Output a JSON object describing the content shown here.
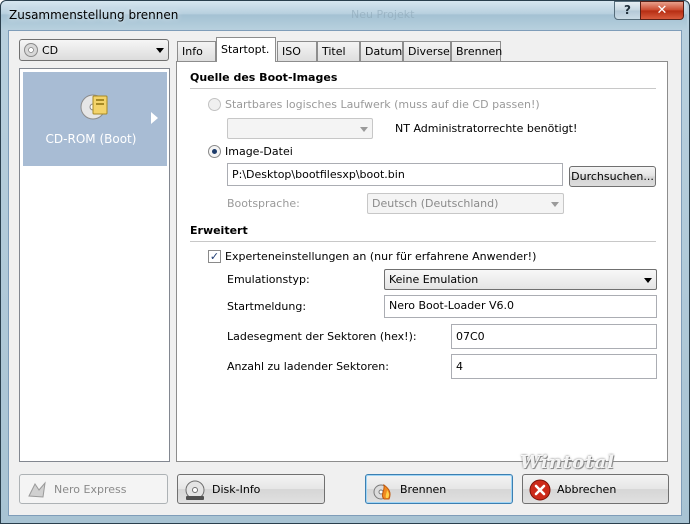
{
  "window": {
    "title": "Zusammenstellung brennen",
    "ghost_title": "Neu Projekt",
    "help_label": "?",
    "close_label": "✕"
  },
  "left": {
    "disc_type": "CD",
    "selected_item": "CD-ROM (Boot)"
  },
  "tabs": [
    {
      "label": "Info"
    },
    {
      "label": "Startopt."
    },
    {
      "label": "ISO"
    },
    {
      "label": "Titel"
    },
    {
      "label": "Datum"
    },
    {
      "label": "Diverse"
    },
    {
      "label": "Brennen"
    }
  ],
  "active_tab": "Startopt.",
  "boot_source": {
    "heading": "Quelle des Boot-Images",
    "drive_option": "Startbares logisches Laufwerk (muss auf die CD passen!)",
    "drive_selected": false,
    "drive_value": "",
    "admin_note": "NT Administratorrechte benötigt!",
    "image_option": "Image-Datei",
    "image_selected": true,
    "image_path": "P:\\Desktop\\bootfilesxp\\boot.bin",
    "browse_button": "Durchsuchen...",
    "language_label": "Bootsprache:",
    "language_value": "Deutsch (Deutschland)"
  },
  "advanced": {
    "heading": "Erweitert",
    "expert_label": "Experteneinstellungen an (nur für erfahrene Anwender!)",
    "expert_checked": true,
    "emulation_label": "Emulationstyp:",
    "emulation_value": "Keine Emulation",
    "start_message_label": "Startmeldung:",
    "start_message_value": "Nero Boot-Loader V6.0",
    "segment_label": "Ladesegment der Sektoren (hex!):",
    "segment_value": "07C0",
    "sector_count_label": "Anzahl zu ladender Sektoren:",
    "sector_count_value": "4"
  },
  "buttons": {
    "nero_express": "Nero Express",
    "disk_info": "Disk-Info",
    "burn": "Brennen",
    "cancel": "Abbrechen"
  },
  "watermark": "Wintotal",
  "colors": {
    "selection": "#a8bcd4",
    "cancel_red": "#cc2a1a",
    "burn_orange": "#f08a20"
  }
}
